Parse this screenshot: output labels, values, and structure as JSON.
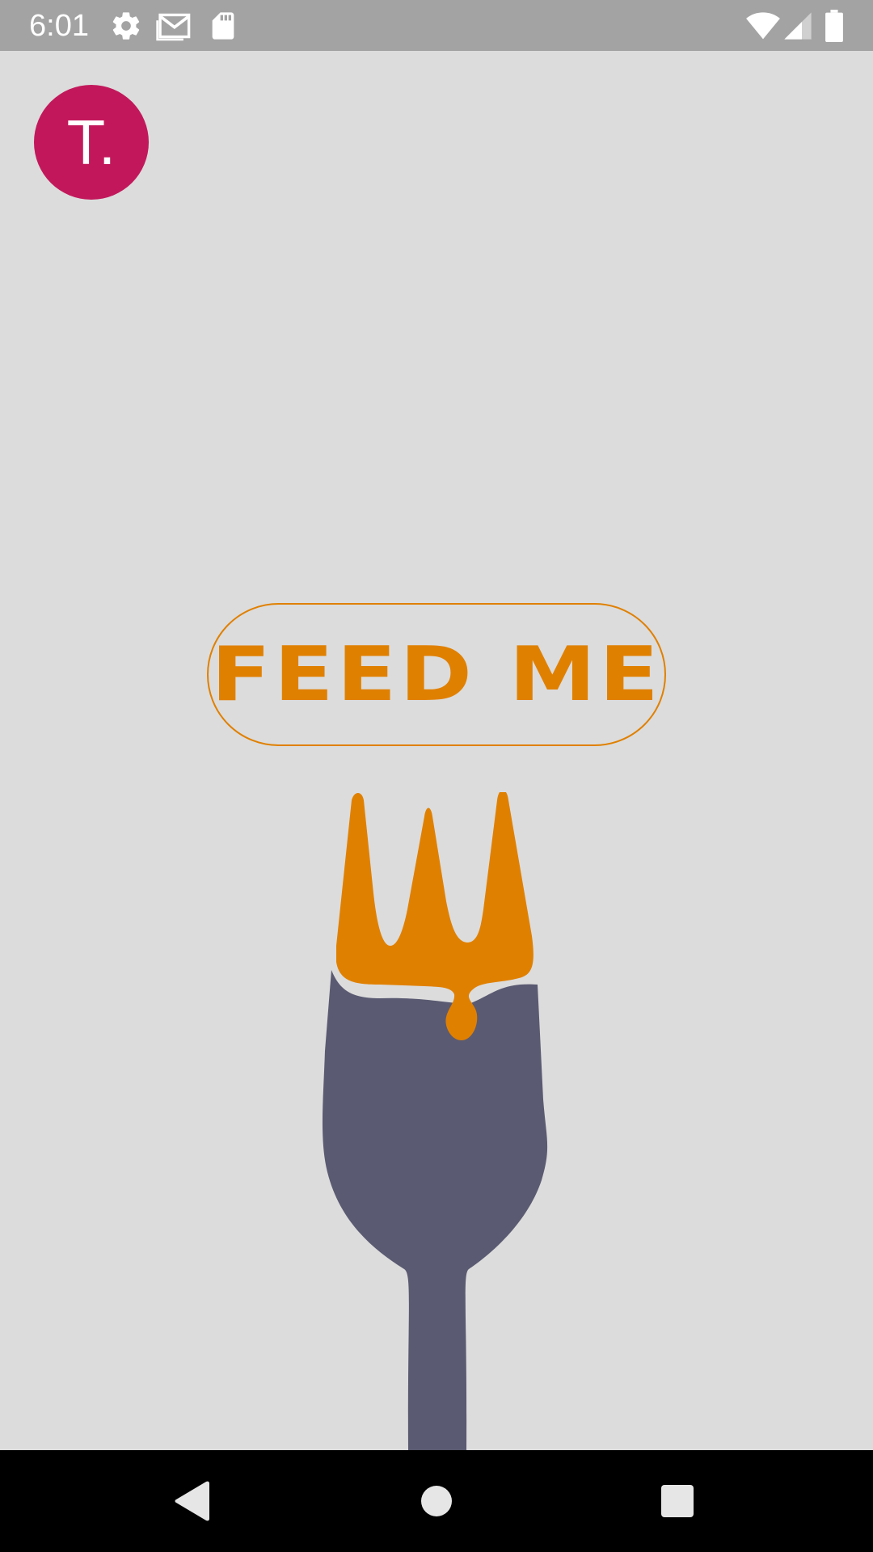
{
  "status_bar": {
    "time": "6:01",
    "icons": [
      "settings-icon",
      "gmail-icon",
      "sd-card-icon",
      "wifi-icon",
      "signal-icon",
      "battery-icon"
    ]
  },
  "avatar": {
    "initial": "T."
  },
  "feed_button": {
    "label": "FEED ME"
  },
  "illustration": {
    "name": "fork-with-honey"
  },
  "nav_bar": {
    "buttons": [
      "back-icon",
      "home-icon",
      "recents-icon"
    ]
  },
  "colors": {
    "background": "#dcdcdc",
    "status_bar": "#a3a3a3",
    "avatar": "#c2185b",
    "accent": "#e08000",
    "fork": "#5a5a72",
    "nav_bar": "#000000"
  }
}
